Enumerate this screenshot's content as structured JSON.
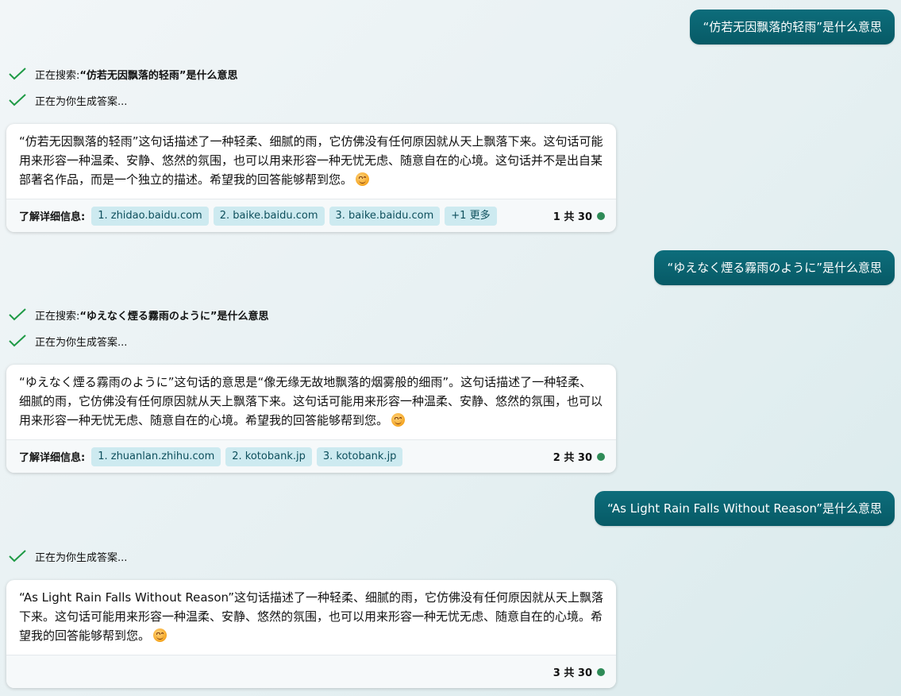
{
  "conversation": [
    {
      "user_message": "“仿若无因飘落的轻雨”是什么意思",
      "status_search_prefix": "正在搜索: ",
      "status_search_query": "“仿若无因飘落的轻雨”是什么意思",
      "status_generating": "正在为你生成答案...",
      "answer": "“仿若无因飘落的轻雨”这句话描述了一种轻柔、细腻的雨，它仿佛没有任何原因就从天上飘落下来。这句话可能用来形容一种温柔、安静、悠然的氛围，也可以用来形容一种无忧无虑、随意自在的心境。这句话并不是出自某部著名作品，而是一个独立的描述。希望我的回答能够帮到您。",
      "learn_more_label": "了解详细信息:",
      "sources": [
        "1. zhidao.baidu.com",
        "2. baike.baidu.com",
        "3. baike.baidu.com",
        "+1 更多"
      ],
      "counter": "1 共 30"
    },
    {
      "user_message": "“ゆえなく煙る霧雨のように”是什么意思",
      "status_search_prefix": "正在搜索: ",
      "status_search_query": "“ゆえなく煙る霧雨のように”是什么意思",
      "status_generating": "正在为你生成答案...",
      "answer": "“ゆえなく煙る霧雨のように”这句话的意思是“像无缘无故地飘落的烟雾般的细雨”。这句话描述了一种轻柔、细腻的雨，它仿佛没有任何原因就从天上飘落下来。这句话可能用来形容一种温柔、安静、悠然的氛围，也可以用来形容一种无忧无虑、随意自在的心境。希望我的回答能够帮到您。",
      "learn_more_label": "了解详细信息:",
      "sources": [
        "1. zhuanlan.zhihu.com",
        "2. kotobank.jp",
        "3. kotobank.jp"
      ],
      "counter": "2 共 30"
    },
    {
      "user_message": "“As Light Rain Falls Without Reason”是什么意思",
      "status_generating": "正在为你生成答案...",
      "answer": "“As Light Rain Falls Without Reason”这句话描述了一种轻柔、细腻的雨，它仿佛没有任何原因就从天上飘落下来。这句话可能用来形容一种温柔、安静、悠然的氛围，也可以用来形容一种无忧无虑、随意自在的心境。希望我的回答能够帮到您。",
      "counter": "3 共 30"
    }
  ],
  "colors": {
    "user_bubble": "#0a6673",
    "check": "#1e9a45",
    "chip_bg": "#cdeaf0",
    "status_dot": "#2e8b57"
  },
  "icons": {
    "status_check": "check-icon",
    "emoji": "smiling-face-emoji"
  }
}
